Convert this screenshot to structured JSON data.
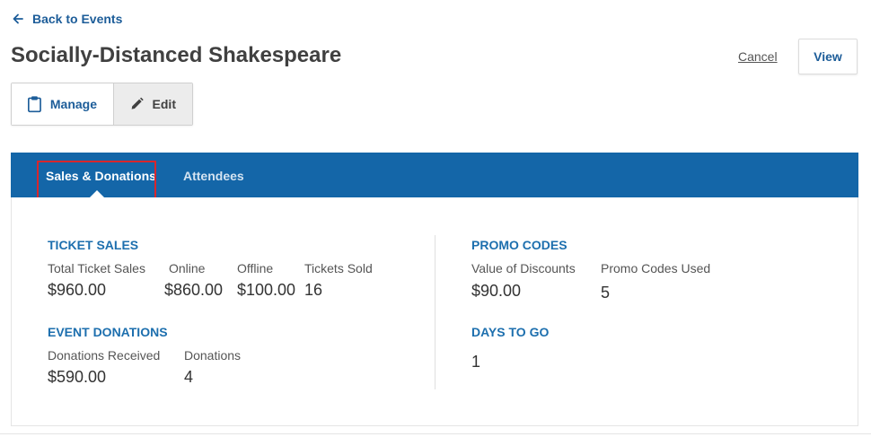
{
  "nav": {
    "back_label": "Back to Events"
  },
  "event": {
    "title": "Socially-Distanced Shakespeare"
  },
  "actions": {
    "cancel_label": "Cancel",
    "view_label": "View"
  },
  "mode_toggle": {
    "manage_label": "Manage",
    "edit_label": "Edit",
    "active": "Edit"
  },
  "tabs": [
    {
      "label": "Sales & Donations",
      "active": true
    },
    {
      "label": "Attendees",
      "active": false
    }
  ],
  "ticket_sales": {
    "title": "TICKET SALES",
    "stats": [
      {
        "label": "Total Ticket Sales",
        "value": "$960.00"
      },
      {
        "label": "Online",
        "value": "$860.00"
      },
      {
        "label": "Offline",
        "value": "$100.00"
      },
      {
        "label": "Tickets Sold",
        "value": "16"
      }
    ]
  },
  "event_donations": {
    "title": "EVENT DONATIONS",
    "stats": [
      {
        "label": "Donations Received",
        "value": "$590.00"
      },
      {
        "label": "Donations",
        "value": "4"
      }
    ]
  },
  "promo_codes": {
    "title": "PROMO CODES",
    "stats": [
      {
        "label": "Value of Discounts",
        "value": "$90.00"
      },
      {
        "label": "Promo Codes Used",
        "value": "5"
      }
    ]
  },
  "days_to_go": {
    "title": "DAYS TO GO",
    "value": "1"
  },
  "colors": {
    "accent": "#1466a8",
    "link": "#1d5d99",
    "highlight": "#d9262c"
  }
}
